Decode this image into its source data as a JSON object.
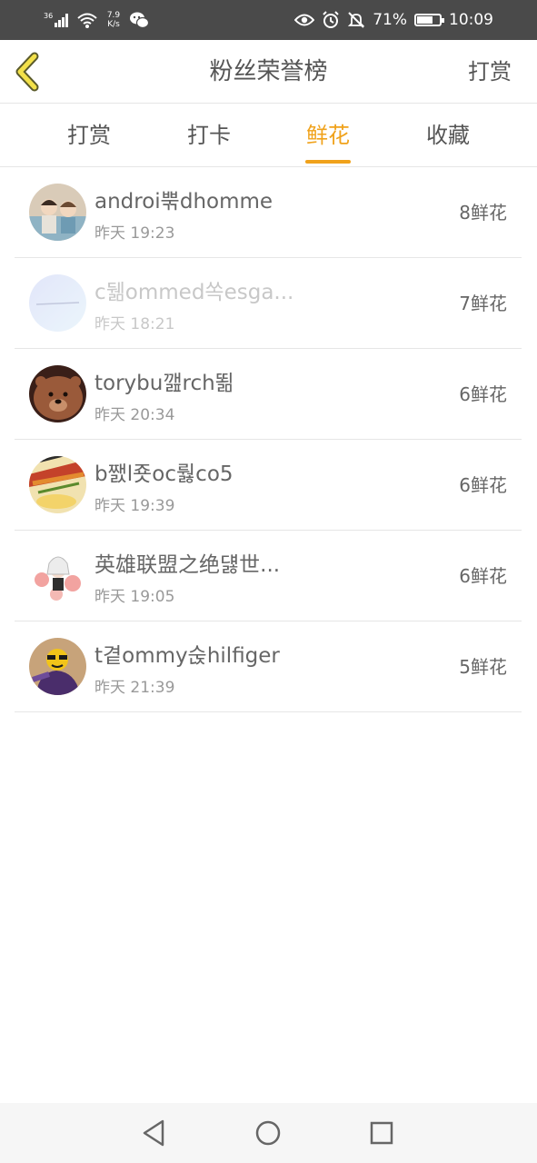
{
  "status_bar": {
    "signal_label": "36",
    "net_speed_value": "7.9",
    "net_speed_unit": "K/s",
    "battery": "71%",
    "battery_level": 0.71,
    "time": "10:09",
    "icons": [
      "signal-icon",
      "wifi-icon",
      "wechat-icon",
      "eye-icon",
      "alarm-icon",
      "mute-bell-icon",
      "battery-icon"
    ]
  },
  "header": {
    "title": "粉丝荣誉榜",
    "action_label": "打赏"
  },
  "tabs": [
    {
      "label": "打赏",
      "active": false
    },
    {
      "label": "打卡",
      "active": false
    },
    {
      "label": "鲜花",
      "active": true
    },
    {
      "label": "收藏",
      "active": false
    }
  ],
  "colors": {
    "accent": "#f0a21b",
    "text": "#555555",
    "muted": "#999999",
    "divider": "#e6e6e6",
    "status_bar": "#4a4a4a"
  },
  "list": [
    {
      "name": "androi뿎dhomme",
      "time": "昨天 19:23",
      "count": "8鲜花"
    },
    {
      "name": "c뒒ommed쏙esga...",
      "time": "昨天 18:21",
      "count": "7鲜花"
    },
    {
      "name": "torybu깶rch뙮",
      "time": "昨天 20:34",
      "count": "6鲜花"
    },
    {
      "name": "b쨄l죳oc뤓co5",
      "time": "昨天 19:39",
      "count": "6鲜花"
    },
    {
      "name": "英雄联盟之绝덇世...",
      "time": "昨天 19:05",
      "count": "6鲜花"
    },
    {
      "name": "t곁ommy숝hilfiger",
      "time": "昨天 21:39",
      "count": "5鲜花"
    }
  ],
  "nav": [
    "back-triangle-icon",
    "home-circle-icon",
    "recents-square-icon"
  ]
}
